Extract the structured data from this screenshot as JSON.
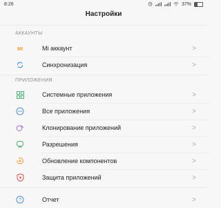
{
  "statusbar": {
    "time": "8:26",
    "battery": "37%"
  },
  "header": {
    "title": "Настройки"
  },
  "sections": {
    "accounts": {
      "label": "АККАУНТЫ"
    },
    "apps": {
      "label": "ПРИЛОЖЕНИЯ"
    }
  },
  "accounts": [
    {
      "label": "Mi аккаунт",
      "icon": "mi-logo-icon"
    },
    {
      "label": "Синхронизация",
      "icon": "sync-icon"
    }
  ],
  "apps": [
    {
      "label": "Системные приложения",
      "icon": "grid-icon"
    },
    {
      "label": "Все приложения",
      "icon": "apps-icon"
    },
    {
      "label": "Клонирование приложений",
      "icon": "clone-icon"
    },
    {
      "label": "Разрешения",
      "icon": "permissions-icon"
    },
    {
      "label": "Обновление компонентов",
      "icon": "update-icon"
    },
    {
      "label": "Защита приложений",
      "icon": "shield-icon"
    }
  ],
  "other": [
    {
      "label": "Отчет",
      "icon": "help-icon"
    }
  ],
  "chevron": ">",
  "colors": {
    "mi_orange": "#f39a32",
    "blue": "#4a90d9",
    "green": "#3fae6a",
    "red": "#e04a4a"
  }
}
